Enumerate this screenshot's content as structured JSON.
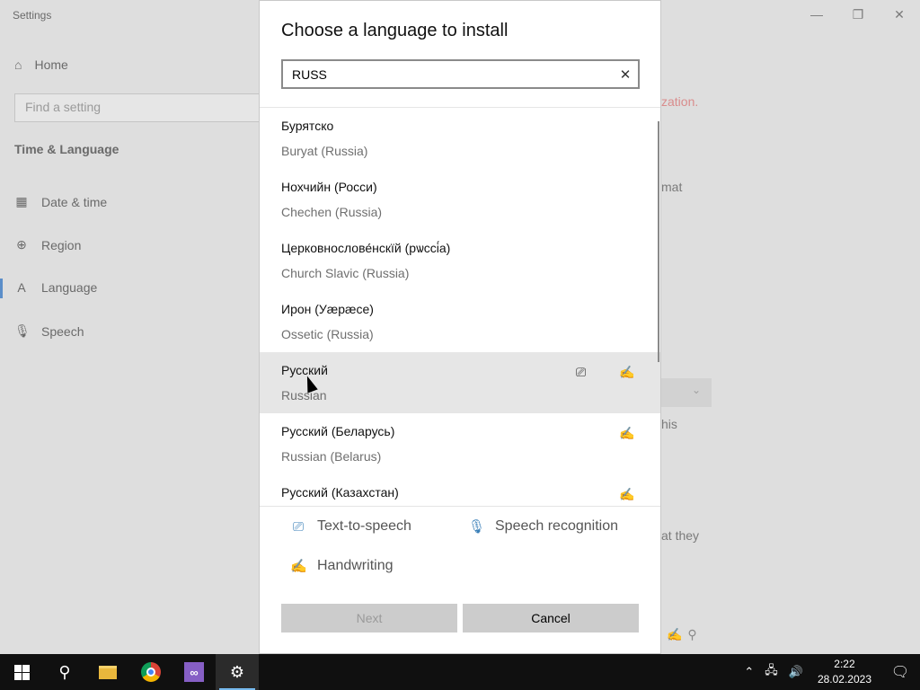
{
  "settings": {
    "window_title": "Settings",
    "controls": {
      "minimize": "—",
      "restore": "❐",
      "close": "✕"
    },
    "sidebar": {
      "home_label": "Home",
      "search_placeholder": "Find a setting",
      "section_title": "Time & Language",
      "items": [
        {
          "label": "Date & time",
          "icon": "calendar-icon"
        },
        {
          "label": "Region",
          "icon": "globe-icon"
        },
        {
          "label": "Language",
          "icon": "language-icon"
        },
        {
          "label": "Speech",
          "icon": "microphone-icon"
        }
      ]
    },
    "background_fragments": [
      "zation.",
      "mat",
      "his",
      "at they"
    ]
  },
  "dialog": {
    "title": "Choose a language to install",
    "search_value": "RUSS",
    "languages": [
      {
        "native": "Бурятско",
        "english": "Buryat (Russia)",
        "tts": false,
        "handwriting": false
      },
      {
        "native": "Нохчийн (Росси)",
        "english": "Chechen (Russia)",
        "tts": false,
        "handwriting": false
      },
      {
        "native": "Церковнослове́нскїй (рѡссі́а)",
        "english": "Church Slavic (Russia)",
        "tts": false,
        "handwriting": false
      },
      {
        "native": "Ирон (Уæрæсе)",
        "english": "Ossetic (Russia)",
        "tts": false,
        "handwriting": false
      },
      {
        "native": "Русский",
        "english": "Russian",
        "tts": true,
        "handwriting": true
      },
      {
        "native": "Русский (Беларусь)",
        "english": "Russian (Belarus)",
        "tts": false,
        "handwriting": true
      },
      {
        "native": "Русский (Казахстан)",
        "english": "",
        "tts": false,
        "handwriting": true
      }
    ],
    "legend": {
      "tts": "Text-to-speech",
      "speech": "Speech recognition",
      "handwriting": "Handwriting"
    },
    "buttons": {
      "next": "Next",
      "cancel": "Cancel"
    }
  },
  "taskbar": {
    "time": "2:22",
    "date": "28.02.2023"
  }
}
